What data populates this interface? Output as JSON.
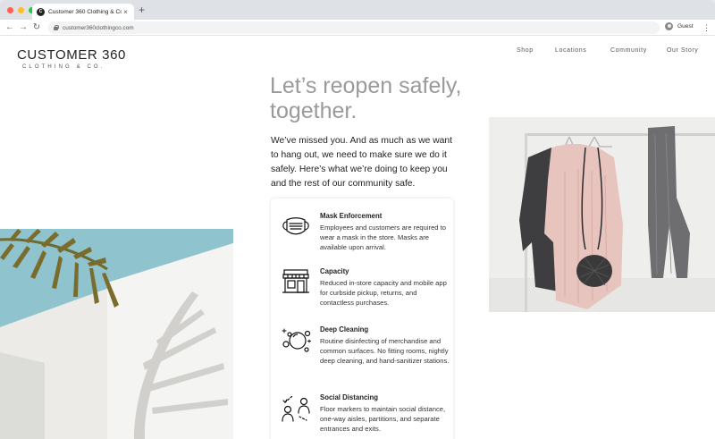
{
  "browser": {
    "tab_title": "Customer 360 Clothing & Co.",
    "tab_close": "×",
    "new_tab": "+",
    "url": "customer360clothingco.com",
    "profile_label": "Guest",
    "back": "←",
    "forward": "→",
    "reload": "↻",
    "menu": "⋮",
    "favicon_text": "C",
    "colors": {
      "close": "#ff5f57",
      "minimize": "#febc2e",
      "maximize": "#28c840"
    }
  },
  "site": {
    "logo_main": "CUSTOMER 360",
    "logo_sub": "CLOTHING & CO.",
    "nav": [
      "Shop",
      "Locations",
      "Community",
      "Our Story"
    ],
    "hero_title_line1": "Let’s reopen safely,",
    "hero_title_line2": "together.",
    "hero_body": "We’ve missed you. And as much as we want to hang out, we need to make sure we do it safely. Here’s what we’re doing to keep you and the rest of our community safe.",
    "policies": [
      {
        "icon": "mask-icon",
        "title": "Mask Enforcement",
        "description": "Employees and customers are required to wear a mask in the store. Masks are available upon arrival."
      },
      {
        "icon": "storefront-icon",
        "title": "Capacity",
        "description": "Reduced in-store capacity and mobile app for curbside pickup, returns, and contactless purchases."
      },
      {
        "icon": "cleaning-bubbles-icon",
        "title": "Deep Cleaning",
        "description": "Routine disinfecting of merchandise and common surfaces. No fitting rooms, nightly deep cleaning, and hand-sanitizer stations."
      },
      {
        "icon": "social-distance-icon",
        "title": "Social Distancing",
        "description": "Floor markers to maintain social distance, one-way aisles, partitions, and separate entrances and exits."
      }
    ]
  }
}
